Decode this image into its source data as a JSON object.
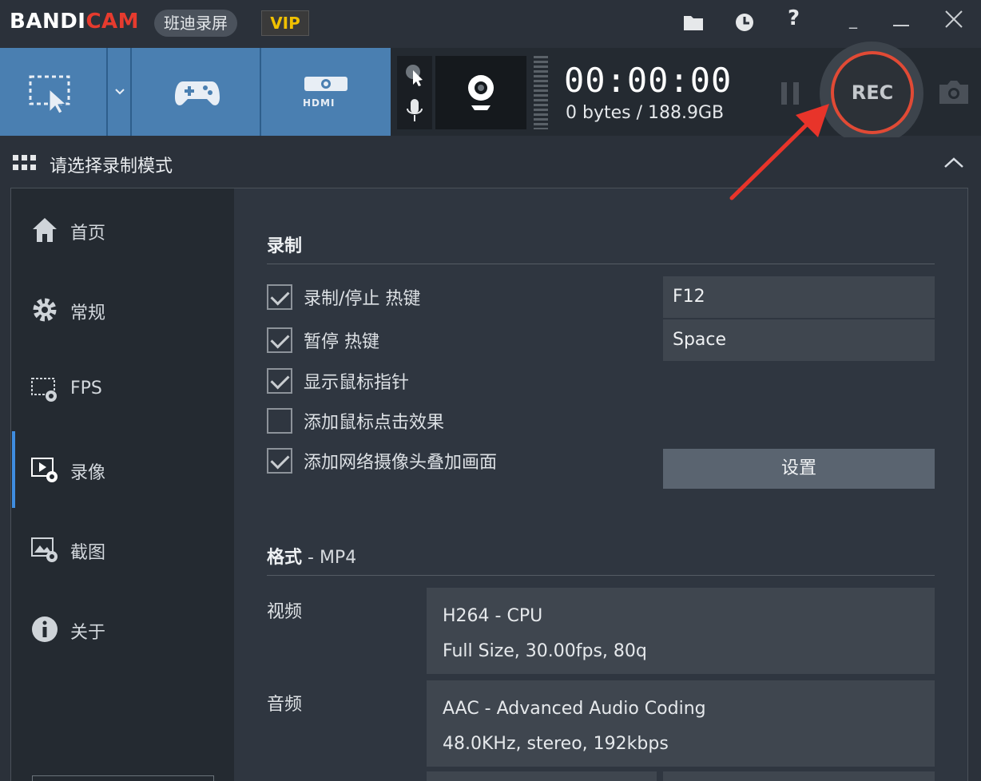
{
  "titlebar": {
    "logo_white": "BANDI",
    "logo_red": "CAM",
    "app_cn_name": "班迪录屏",
    "vip": "VIP",
    "minimize": "_",
    "help": "?"
  },
  "toolbar": {
    "timer": "00:00:00",
    "size": "0 bytes / 188.9GB",
    "rec": "REC",
    "hdmi": "HDMI"
  },
  "mode": {
    "title": "请选择录制模式"
  },
  "sidebar": {
    "items": [
      {
        "label": "首页",
        "icon": "home-icon"
      },
      {
        "label": "常规",
        "icon": "gear-icon"
      },
      {
        "label": "FPS",
        "icon": "fps-icon"
      },
      {
        "label": "录像",
        "icon": "video-settings-icon",
        "active": true
      },
      {
        "label": "截图",
        "icon": "image-settings-icon"
      },
      {
        "label": "关于",
        "icon": "info-icon"
      }
    ]
  },
  "record": {
    "title": "录制",
    "options": [
      {
        "label": "录制/停止 热键",
        "checked": true
      },
      {
        "label": "暂停 热键",
        "checked": true
      },
      {
        "label": "显示鼠标指针",
        "checked": true
      },
      {
        "label": "添加鼠标点击效果",
        "checked": false
      },
      {
        "label": "添加网络摄像头叠加画面",
        "checked": true
      }
    ],
    "hotkey_record": "F12",
    "hotkey_pause": "Space",
    "settings_button": "设置"
  },
  "format": {
    "title": "格式",
    "subtitle": " - MP4",
    "video_label": "视频",
    "video_codec": "H264 - CPU",
    "video_detail": "Full Size, 30.00fps, 80q",
    "audio_label": "音频",
    "audio_codec": "AAC - Advanced Audio Coding",
    "audio_detail": "48.0KHz, stereo, 192kbps"
  },
  "colors": {
    "accent_blue": "#4a7fb1",
    "rec_red": "#e14a35",
    "annotation_arrow": "#e8342a"
  }
}
